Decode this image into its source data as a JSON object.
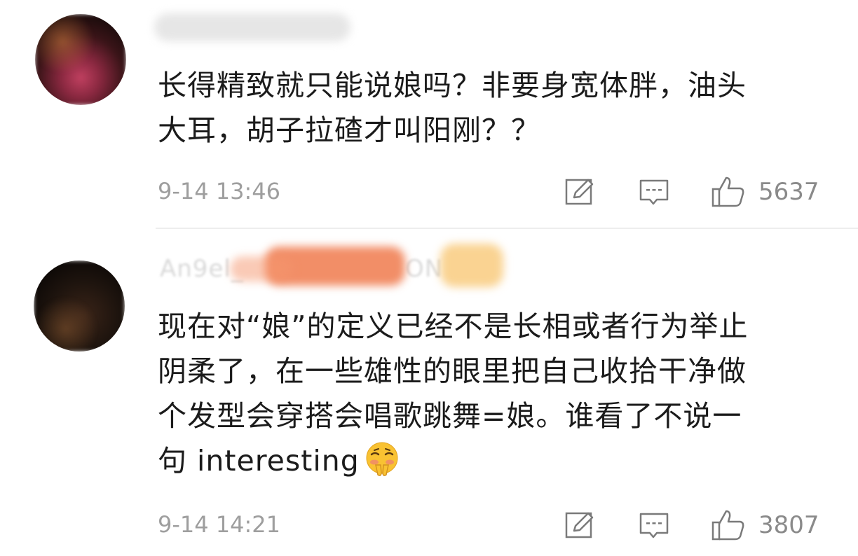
{
  "comments": [
    {
      "username": "",
      "text_lines": [
        "长得精致就只能说娘吗？非要身宽体胖，油头",
        "大耳，胡子拉碴才叫阳刚？？"
      ],
      "time": "9-14 13:46",
      "likes": "5637"
    },
    {
      "username": "An9el_",
      "username_tail": "ON",
      "text_lines": [
        "现在对“娘”的定义已经不是长相或者行为举止",
        "阴柔了，在一些雄性的眼里把自己收拾干净做",
        "个发型会穿搭会唱歌跳舞=娘。谁看了不说一",
        "句 interesting"
      ],
      "time": "9-14 14:21",
      "likes": "3807",
      "emoji": "pleading-face-emoji"
    }
  ],
  "icons": {
    "edit": "edit-icon",
    "reply": "comment-icon",
    "like": "thumbs-up-icon"
  },
  "colors": {
    "text": "#1b1b1b",
    "meta": "#9e9e9e",
    "divider": "#ededed"
  }
}
